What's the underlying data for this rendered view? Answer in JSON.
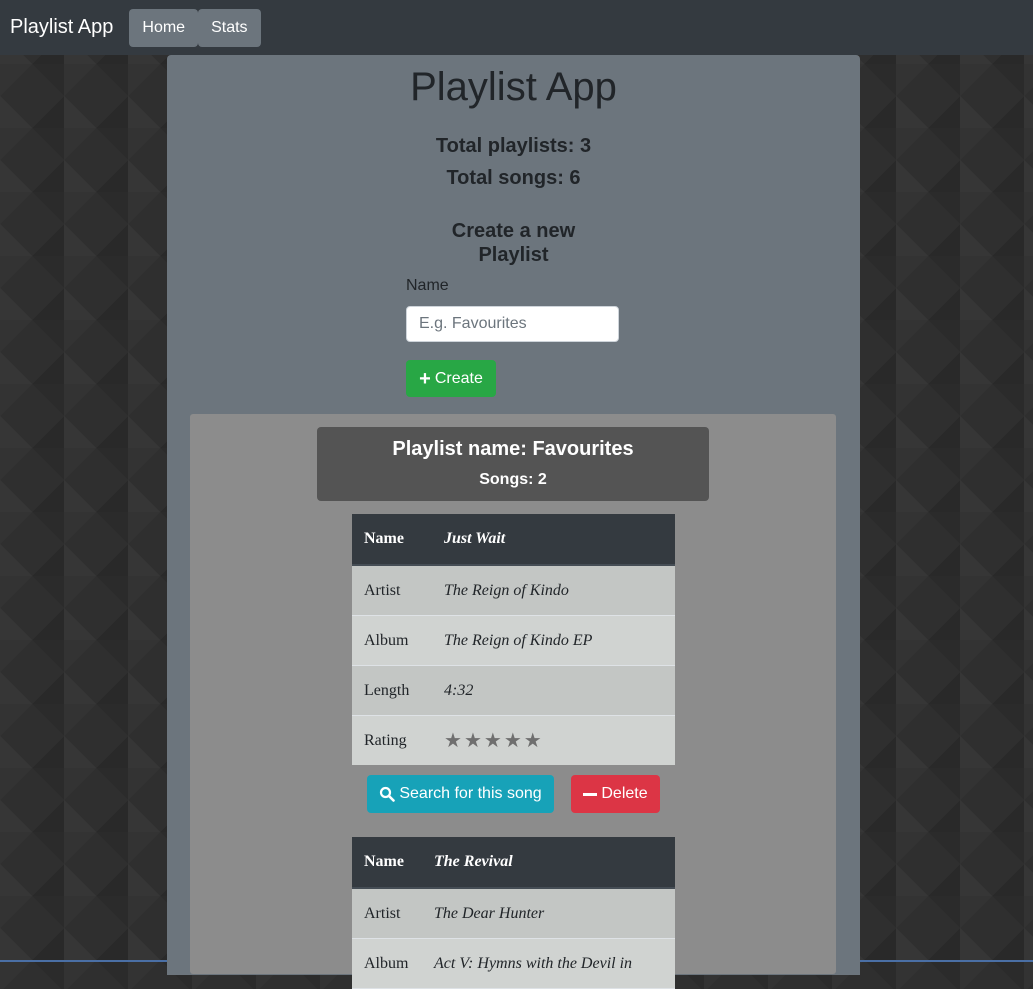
{
  "navbar": {
    "brand": "Playlist App",
    "items": [
      "Home",
      "Stats"
    ]
  },
  "main": {
    "title": "Playlist App",
    "total_playlists": "Total playlists: 3",
    "total_songs": "Total songs: 6",
    "create_heading_line1": "Create a new",
    "create_heading_line2": "Playlist",
    "name_label": "Name",
    "name_placeholder": "E.g. Favourites",
    "name_value": "",
    "create_label": "Create"
  },
  "playlist": {
    "name": "Playlist name: Favourites",
    "count": "Songs: 2",
    "songs": [
      {
        "name_key": "Name",
        "name": "Just Wait",
        "artist_key": "Artist",
        "artist": "The Reign of Kindo",
        "album_key": "Album",
        "album": "The Reign of Kindo EP",
        "length_key": "Length",
        "length": "4:32",
        "rating_key": "Rating",
        "rating": 5
      },
      {
        "name_key": "Name",
        "name": "The Revival",
        "artist_key": "Artist",
        "artist": "The Dear Hunter",
        "album_key": "Album",
        "album": "Act V: Hymns with the Devil in"
      }
    ],
    "search_label": "Search for this song",
    "delete_label": "Delete"
  },
  "colors": {
    "navbar": "#343a40",
    "container": "#6c757d",
    "create": "#28a745",
    "search": "#17a2b8",
    "delete": "#dc3545"
  },
  "icons": [
    "plus-icon",
    "search-icon",
    "minus-icon",
    "star-icon"
  ]
}
